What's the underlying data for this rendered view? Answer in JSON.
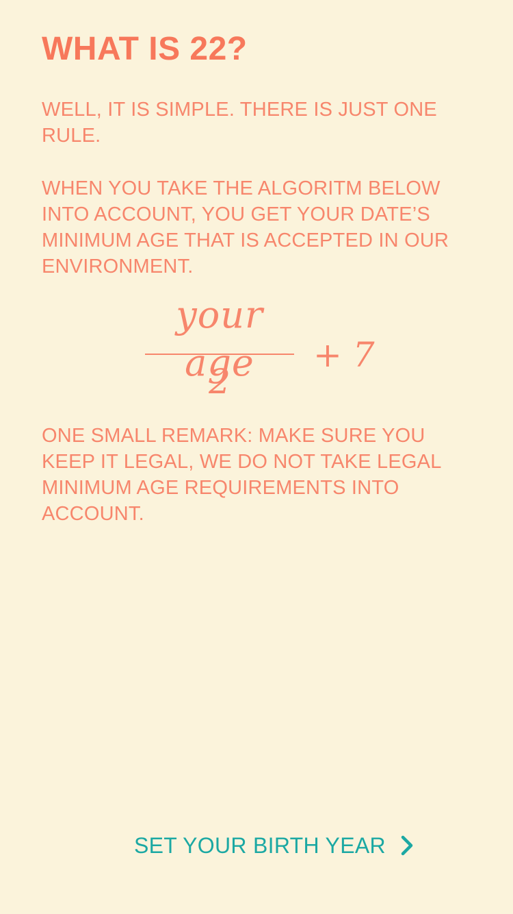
{
  "header": {
    "title": "WHAT IS 22?"
  },
  "content": {
    "paragraph_1": "WELL, IT IS SIMPLE. THERE IS JUST ONE RULE.",
    "paragraph_2": "WHEN YOU TAKE THE ALGORITM BELOW INTO ACCOUNT, YOU GET YOUR DATE’S MINIMUM AGE THAT IS ACCEPTED IN OUR ENVIRONMENT.",
    "formula": {
      "numerator": "your age",
      "denominator": "2",
      "addend": "+ 7"
    },
    "paragraph_3": "ONE SMALL REMARK: MAKE SURE YOU KEEP IT LEGAL, WE DO NOT TAKE LEGAL MINIMUM AGE REQUIREMENTS INTO ACCOUNT."
  },
  "footer": {
    "cta_label": "SET YOUR BIRTH YEAR",
    "cta_icon": "chevron-right-icon"
  },
  "colors": {
    "background": "#FBF3DB",
    "text_accent": "#F7866C",
    "title": "#F7785B",
    "cta": "#1BA8A3"
  }
}
